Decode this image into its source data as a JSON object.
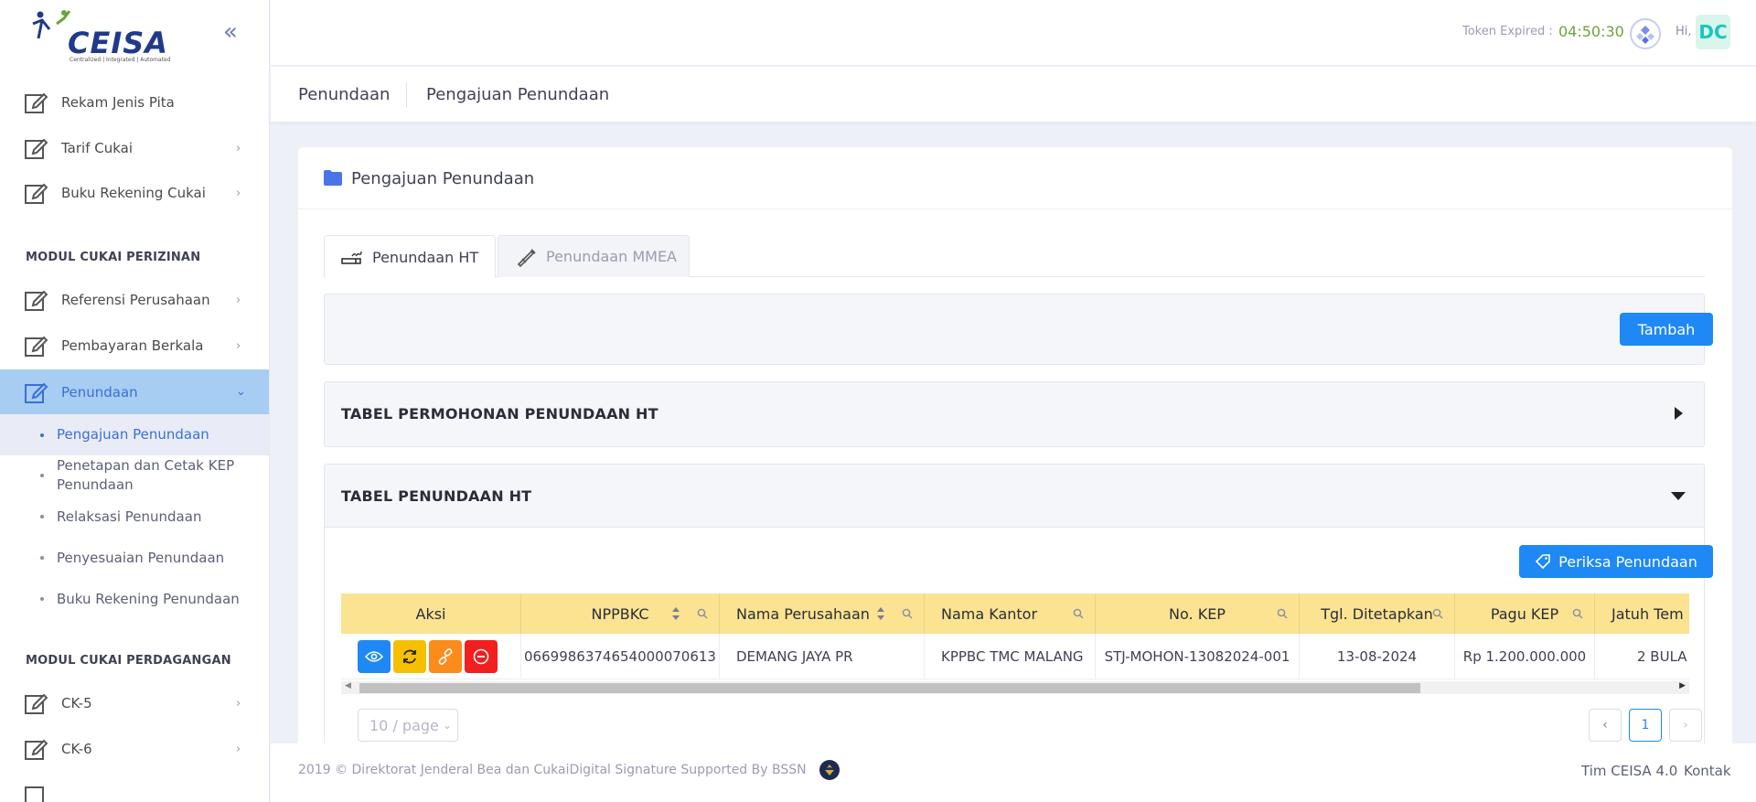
{
  "logo": {
    "text": "CEISA",
    "tagline": "Centralized | Integrated | Automated"
  },
  "sidebar": {
    "items_top": [
      {
        "label": "Rekam Jenis Pita",
        "chevron": ""
      },
      {
        "label": "Tarif Cukai",
        "chevron": "›"
      },
      {
        "label": "Buku Rekening Cukai",
        "chevron": "›"
      }
    ],
    "section1": "MODUL CUKAI PERIZINAN",
    "items_mid": [
      {
        "label": "Referensi Perusahaan",
        "chevron": "›"
      },
      {
        "label": "Pembayaran Berkala",
        "chevron": "›"
      },
      {
        "label": "Penundaan",
        "chevron": "⌄"
      }
    ],
    "subitems": [
      {
        "label": "Pengajuan Penundaan"
      },
      {
        "label": "Penetapan dan Cetak KEP Penundaan"
      },
      {
        "label": "Relaksasi Penundaan"
      },
      {
        "label": "Penyesuaian Penundaan"
      },
      {
        "label": "Buku Rekening Penundaan"
      }
    ],
    "section2": "MODUL CUKAI PERDAGANGAN",
    "items_bottom": [
      {
        "label": "CK-5",
        "chevron": "›"
      },
      {
        "label": "CK-6",
        "chevron": "›"
      }
    ]
  },
  "header": {
    "token_label": "Token Expired :",
    "token_time": "04:50:30",
    "greeting": "Hi,",
    "avatar_initials": "DC"
  },
  "breadcrumb": {
    "parent": "Penundaan",
    "current": "Pengajuan Penundaan"
  },
  "card": {
    "title": "Pengajuan Penundaan",
    "tabs": [
      {
        "label": "Penundaan HT",
        "icon": "cigarette-icon"
      },
      {
        "label": "Penundaan MMEA",
        "icon": "bottle-icon"
      }
    ],
    "tambah_label": "Tambah",
    "accordion1_title": "TABEL PERMOHONAN PENUNDAAN HT",
    "accordion2_title": "TABEL PENUNDAAN HT",
    "periksa_label": "Periksa Penundaan"
  },
  "table": {
    "columns": [
      "Aksi",
      "NPPBKC",
      "Nama Perusahaan",
      "Nama Kantor",
      "No. KEP",
      "Tgl. Ditetapkan",
      "Pagu KEP",
      "Jatuh Tem"
    ],
    "rows": [
      {
        "nppbkc": "066998637465400007061​3",
        "nama_perusahaan": "DEMANG JAYA PR",
        "nama_kantor": "KPPBC TMC MALANG",
        "no_kep": "STJ-MOHON-13082024-001",
        "tgl_ditetapkan": "13-08-2024",
        "pagu_kep": "Rp 1.200.000.000",
        "jatuh_tempo": "2 BULA"
      }
    ],
    "action_colors": {
      "view": "#1e88f5",
      "refresh": "#f6c000",
      "link": "#fb8c1c",
      "delete": "#f31e1e"
    }
  },
  "pagination": {
    "page_size": "10 / page",
    "current_page": "1",
    "prev": "‹",
    "next": "›"
  },
  "footer": {
    "copyright": "2019 © Direktorat Jenderal Bea dan CukaiDigital Signature Supported By BSSN",
    "link1": "Tim CEISA 4.0",
    "link2": "Kontak"
  }
}
